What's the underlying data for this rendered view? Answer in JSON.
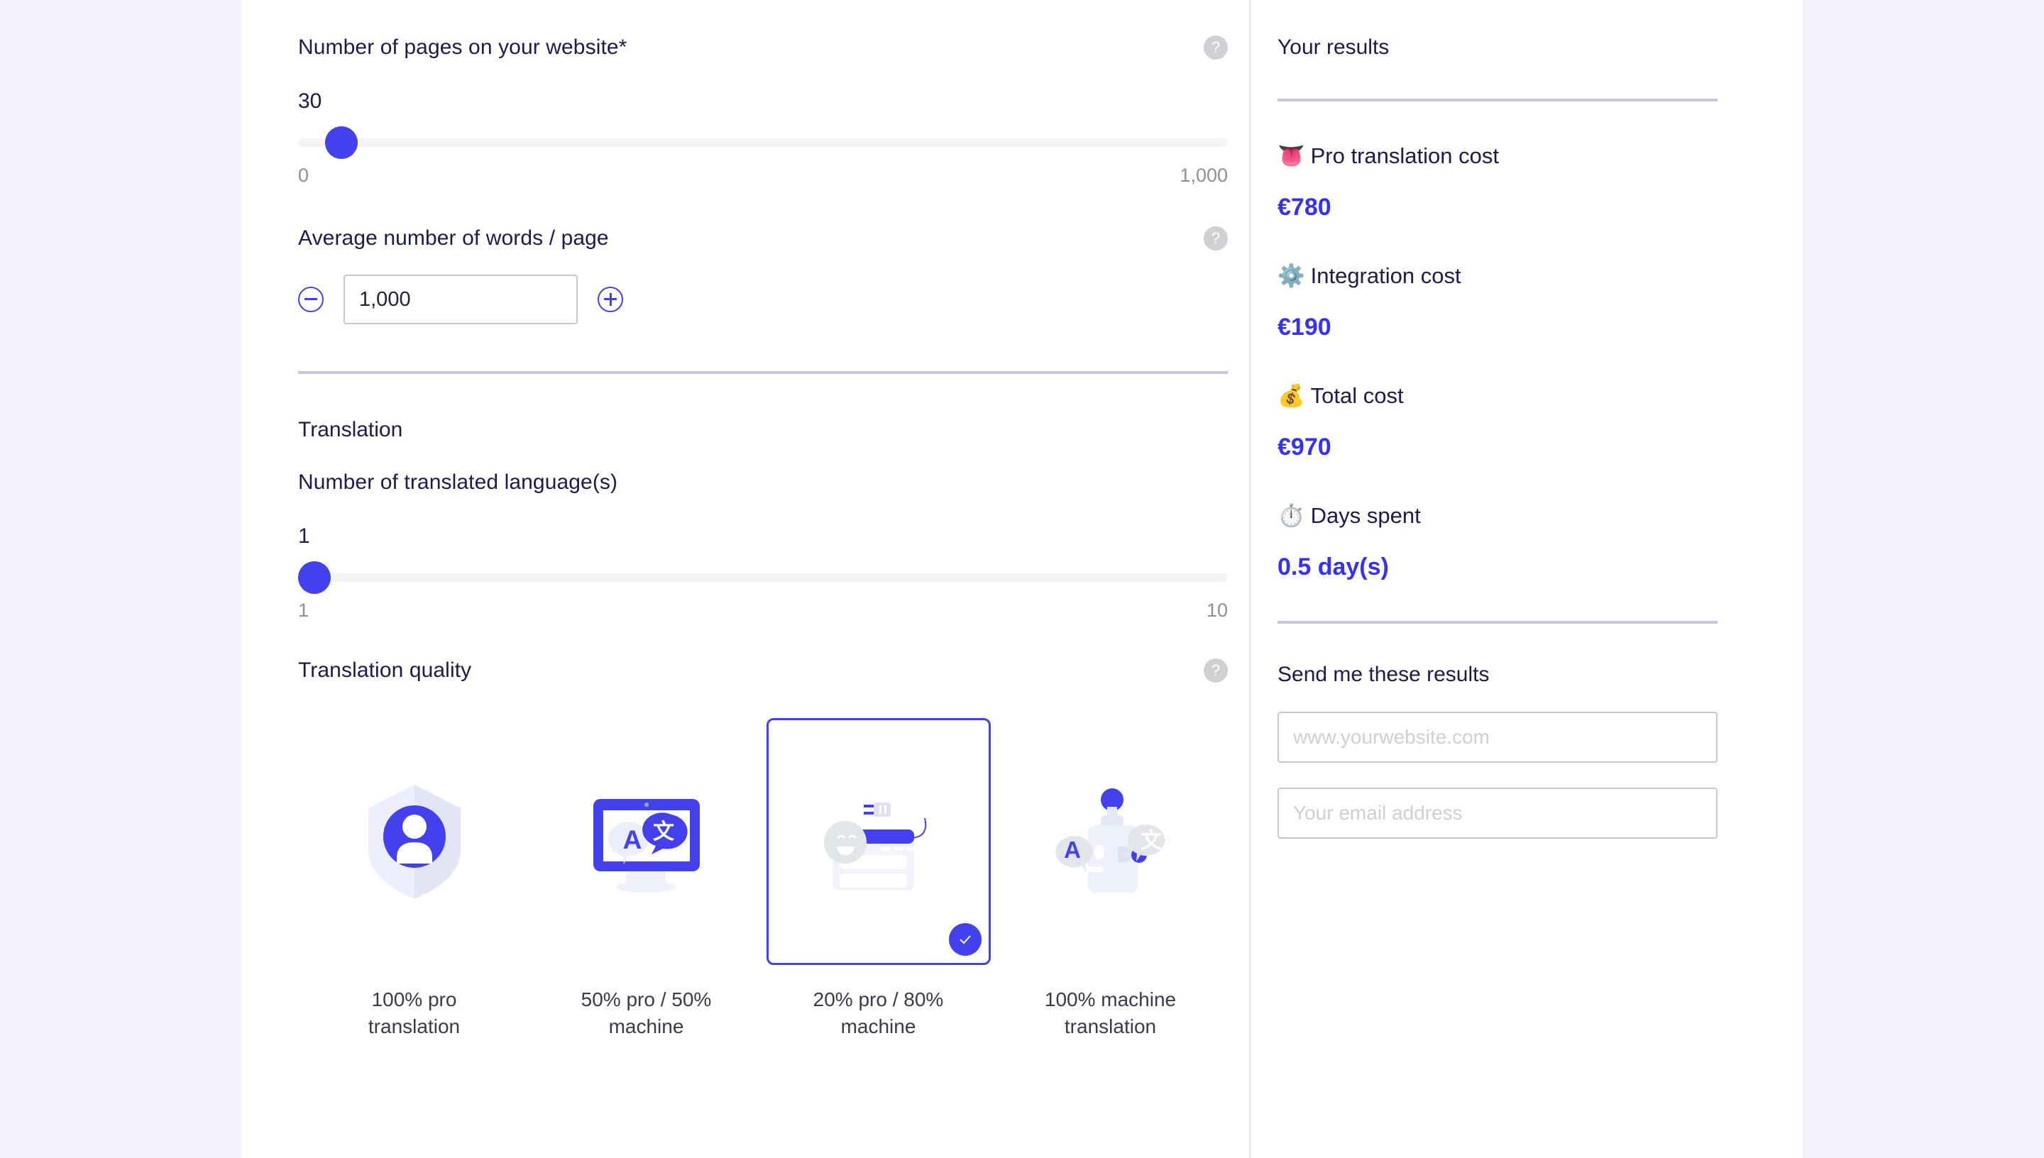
{
  "colors": {
    "accent": "#4340ee",
    "accent_text": "#3531f5",
    "heading": "#1d1b4c",
    "page_bg": "#f4f4fe",
    "divider": "#c6c4ea",
    "track": "#f4f4f6"
  },
  "form": {
    "pages_field": {
      "label": "Number of pages on your website*",
      "help_icon": "question-mark-icon",
      "value": "30",
      "min_label": "0",
      "max_label": "1,000",
      "min": 0,
      "max": 1000,
      "current": 30
    },
    "words_field": {
      "label": "Average number of words / page",
      "help_icon": "question-mark-icon",
      "value": "1,000",
      "decrement_label": "−",
      "increment_label": "+"
    },
    "translation_section": {
      "title": "Translation",
      "languages_field": {
        "label": "Number of translated language(s)",
        "value": "1",
        "min_label": "1",
        "max_label": "10",
        "min": 1,
        "max": 10,
        "current": 1
      },
      "quality_field": {
        "label": "Translation quality",
        "help_icon": "question-mark-icon",
        "options": [
          {
            "label": "100% pro translation",
            "icon": "shield-person-icon",
            "selected": false
          },
          {
            "label": "50% pro / 50% machine",
            "icon": "monitor-translate-icon",
            "selected": false
          },
          {
            "label": "20% pro / 80% machine",
            "icon": "plugin-smiley-icon",
            "selected": true
          },
          {
            "label": "100% machine translation",
            "icon": "robot-translate-icon",
            "selected": false
          }
        ],
        "selected_badge_icon": "check-icon"
      }
    }
  },
  "results": {
    "title": "Your results",
    "items": [
      {
        "emoji": "👅",
        "icon": "tongue-icon",
        "label": "Pro translation cost",
        "value": "€780"
      },
      {
        "emoji": "⚙️",
        "icon": "gear-icon",
        "label": "Integration cost",
        "value": "€190"
      },
      {
        "emoji": "💰",
        "icon": "money-bag-icon",
        "label": "Total cost",
        "value": "€970"
      },
      {
        "emoji": "⏱️",
        "icon": "stopwatch-icon",
        "label": "Days spent",
        "value": "0.5 day(s)"
      }
    ],
    "send": {
      "title": "Send me these results",
      "website_placeholder": "www.yourwebsite.com",
      "website_value": "",
      "email_placeholder": "Your email address",
      "email_value": ""
    }
  }
}
